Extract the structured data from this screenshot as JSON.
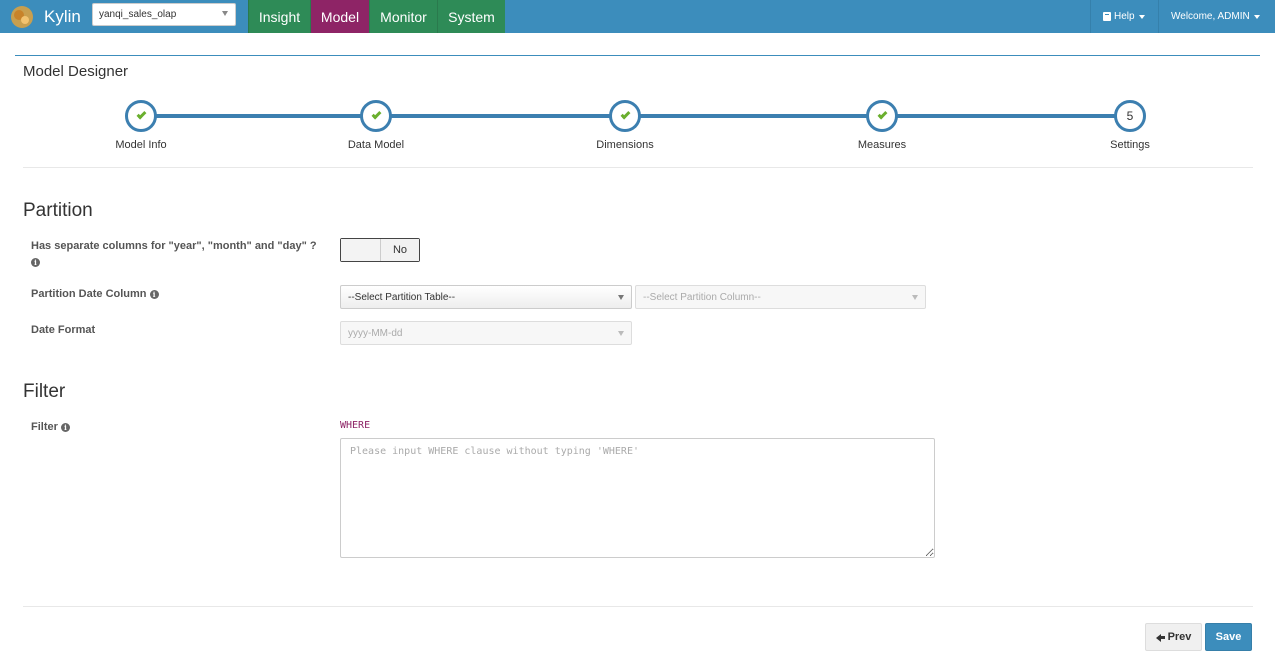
{
  "navbar": {
    "brand": "Kylin",
    "project_select": "yanqi_sales_olap",
    "tabs": [
      {
        "label": "Insight",
        "active": false
      },
      {
        "label": "Model",
        "active": true
      },
      {
        "label": "Monitor",
        "active": false
      },
      {
        "label": "System",
        "active": false
      }
    ],
    "help": "Help",
    "welcome": "Welcome, ADMIN"
  },
  "page": {
    "title": "Model Designer"
  },
  "wizard": {
    "steps": [
      {
        "label": "Model Info",
        "done": true
      },
      {
        "label": "Data Model",
        "done": true
      },
      {
        "label": "Dimensions",
        "done": true
      },
      {
        "label": "Measures",
        "done": true
      },
      {
        "label": "Settings",
        "number": "5",
        "done": false
      }
    ]
  },
  "partition": {
    "title": "Partition",
    "separate_columns_label": "Has separate columns for \"year\", \"month\" and \"day\" ?",
    "toggle_value": "No",
    "date_column_label": "Partition Date Column",
    "table_select": "--Select Partition Table--",
    "column_select": "--Select Partition Column--",
    "date_format_label": "Date Format",
    "date_format_select": "yyyy-MM-dd"
  },
  "filter": {
    "title": "Filter",
    "label": "Filter",
    "keyword": "WHERE",
    "placeholder": "Please input WHERE clause without typing 'WHERE'"
  },
  "footer": {
    "prev": "Prev",
    "save": "Save"
  },
  "colors": {
    "navbar": "#3c8dbc",
    "tab": "#2e8b57",
    "tab_active": "#8e2466",
    "wizard_line": "#3c7fb0",
    "check": "#6aaf2e"
  }
}
